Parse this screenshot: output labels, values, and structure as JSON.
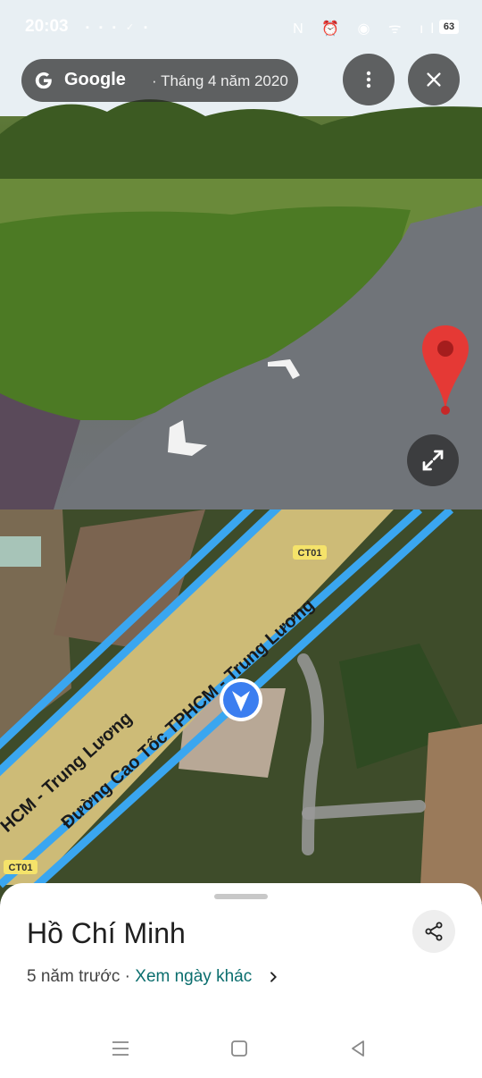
{
  "status_bar": {
    "time": "20:03",
    "battery": "63",
    "left_icons": [
      "notification-icon",
      "app-icon",
      "app-icon",
      "check-icon",
      "app-icon"
    ],
    "right_icons": [
      "nfc-icon",
      "alarm-icon",
      "location-icon",
      "wifi-icon",
      "signal-icon"
    ]
  },
  "street_view": {
    "brand": "Google",
    "date_label": "· Tháng 4 năm 2020",
    "more_icon": "more-vert-icon",
    "close_icon": "close-icon",
    "expand_icon": "expand-icon",
    "pin_icon": "map-pin-icon"
  },
  "map": {
    "road_label": "Đường Cao Tốc TPHCM - Trung Lương",
    "road_label_partial": "HCM - Trung Lương",
    "shield_1": "CT01",
    "shield_2": "CT01",
    "colors": {
      "highway": "#d8c77a",
      "street_view_line": "#3aa6f0",
      "user_marker": "#3b7ef0"
    }
  },
  "sheet": {
    "place_name": "Hồ Chí Minh",
    "age": "5 năm trước",
    "separator": " · ",
    "other_dates_link": "Xem ngày khác",
    "share_icon": "share-icon",
    "chevron_icon": "chevron-right-icon"
  },
  "nav_bar": {
    "recents_icon": "recents-icon",
    "home_icon": "home-icon",
    "back_icon": "back-icon"
  }
}
